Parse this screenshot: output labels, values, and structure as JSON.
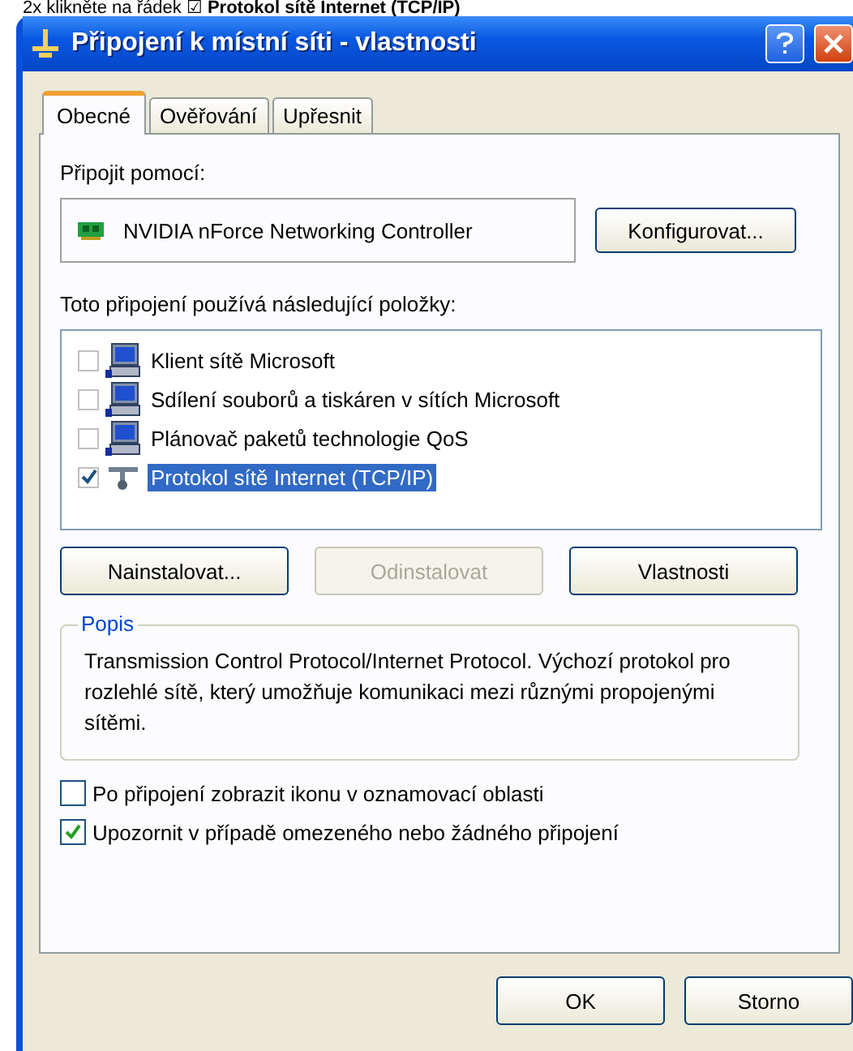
{
  "caption": "2x klikněte na řádek ☑ **Protokol sítě Internet (TCP/IP)**",
  "window": {
    "title": "Připojení k místní síti - vlastnosti"
  },
  "tabs": [
    {
      "label": "Obecné",
      "selected": true
    },
    {
      "label": "Ověřování",
      "selected": false
    },
    {
      "label": "Upřesnit",
      "selected": false
    }
  ],
  "connect_using": {
    "label": "Připojit pomocí:",
    "adapter": "NVIDIA nForce Networking Controller",
    "button": "Konfigurovat..."
  },
  "components": {
    "label": "Toto připojení používá následující položky:",
    "items": [
      {
        "label": "Klient sítě Microsoft",
        "checked": false,
        "selected": false,
        "kind": "computer"
      },
      {
        "label": "Sdílení souborů a tiskáren v sítích Microsoft",
        "checked": false,
        "selected": false,
        "kind": "computer"
      },
      {
        "label": "Plánovač paketů technologie QoS",
        "checked": false,
        "selected": false,
        "kind": "computer"
      },
      {
        "label": "Protokol sítě Internet (TCP/IP)",
        "checked": true,
        "selected": true,
        "kind": "protocol"
      }
    ]
  },
  "buttons": [
    {
      "label": "Nainstalovat...",
      "disabled": false
    },
    {
      "label": "Odinstalovat",
      "disabled": true
    },
    {
      "label": "Vlastnosti",
      "disabled": false
    }
  ],
  "description": {
    "title": "Popis",
    "text": "Transmission Control Protocol/Internet Protocol. Výchozí protokol pro rozlehlé sítě, který umožňuje komunikaci mezi různými propojenými sítěmi."
  },
  "options": [
    {
      "label": "Po připojení zobrazit ikonu v oznamovací oblasti",
      "checked": false
    },
    {
      "label": "Upozornit v případě omezeného nebo žádného připojení",
      "checked": true
    }
  ],
  "dialog_buttons": [
    "OK",
    "Storno"
  ]
}
